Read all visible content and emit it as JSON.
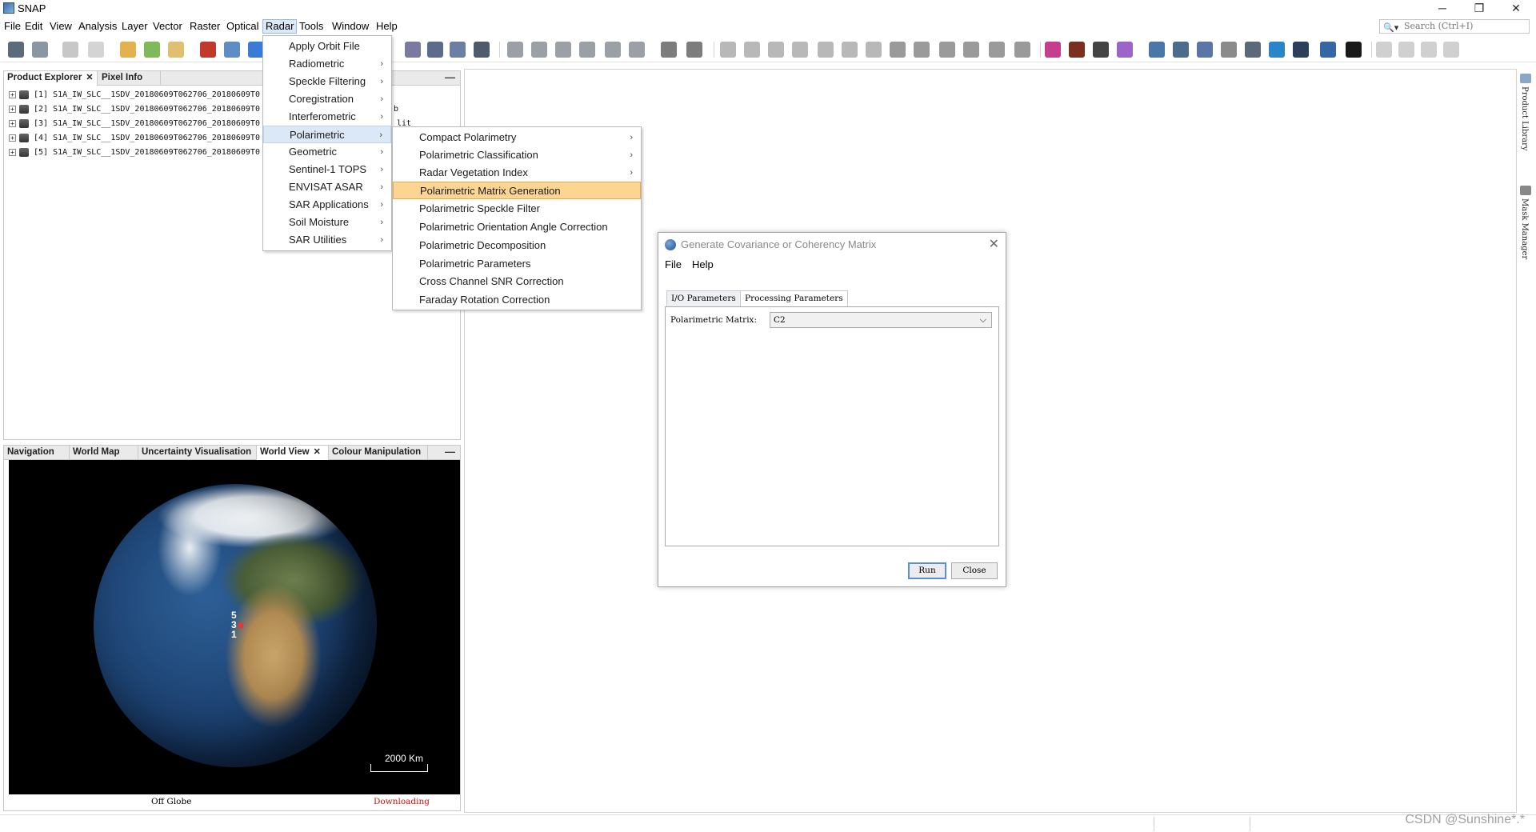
{
  "window": {
    "title": "SNAP",
    "controls": [
      "─",
      "❐",
      "✕"
    ]
  },
  "menubar": {
    "items": [
      "File",
      "Edit",
      "View",
      "Analysis",
      "Layer",
      "Vector",
      "Raster",
      "Optical",
      "Radar",
      "Tools",
      "Window",
      "Help"
    ],
    "active": "Radar",
    "search_placeholder": "Search (Ctrl+I)"
  },
  "product_explorer": {
    "tabs": [
      "Product Explorer",
      "Pixel Info"
    ],
    "minimize": "—",
    "products": [
      "[1] S1A_IW_SLC__1SDV_20180609T062706_20180609T0",
      "[2] S1A_IW_SLC__1SDV_20180609T062706_20180609T0",
      "[3] S1A_IW_SLC__1SDV_20180609T062706_20180609T0",
      "[4] S1A_IW_SLC__1SDV_20180609T062706_20180609T0",
      "[5] S1A_IW_SLC__1SDV_20180609T062706_20180609T0"
    ],
    "behind_text": [
      "b",
      "lit"
    ]
  },
  "world_view_panel": {
    "tabs": [
      "Navigation",
      "World Map",
      "Uncertainty Visualisation",
      "World View",
      "Colour Manipulation"
    ],
    "minimize": "—",
    "markers": [
      "5",
      "3",
      "1"
    ],
    "scale_label": "2000 Km",
    "status_left": "Off Globe",
    "status_right": "Downloading",
    "status_right_color": "#d01010"
  },
  "radar_menu": {
    "items": [
      {
        "label": "Apply Orbit File",
        "submenu": false
      },
      {
        "label": "Radiometric",
        "submenu": true
      },
      {
        "label": "Speckle Filtering",
        "submenu": true
      },
      {
        "label": "Coregistration",
        "submenu": true
      },
      {
        "label": "Interferometric",
        "submenu": true
      },
      {
        "label": "Polarimetric",
        "submenu": true
      },
      {
        "label": "Geometric",
        "submenu": true
      },
      {
        "label": "Sentinel-1 TOPS",
        "submenu": true
      },
      {
        "label": "ENVISAT ASAR",
        "submenu": true
      },
      {
        "label": "SAR Applications",
        "submenu": true
      },
      {
        "label": "Soil Moisture",
        "submenu": true
      },
      {
        "label": "SAR Utilities",
        "submenu": true
      }
    ],
    "hovered": "Polarimetric"
  },
  "polarimetric_menu": {
    "items": [
      {
        "label": "Compact Polarimetry",
        "submenu": true
      },
      {
        "label": "Polarimetric Classification",
        "submenu": true
      },
      {
        "label": "Radar Vegetation Index",
        "submenu": true
      },
      {
        "label": "Polarimetric Matrix Generation",
        "submenu": false
      },
      {
        "label": "Polarimetric Speckle Filter",
        "submenu": false
      },
      {
        "label": "Polarimetric Orientation Angle Correction",
        "submenu": false
      },
      {
        "label": "Polarimetric Decomposition",
        "submenu": false
      },
      {
        "label": "Polarimetric Parameters",
        "submenu": false
      },
      {
        "label": "Cross Channel SNR Correction",
        "submenu": false
      },
      {
        "label": "Faraday Rotation Correction",
        "submenu": false
      }
    ],
    "highlighted": "Polarimetric Matrix Generation",
    "arrow": "›"
  },
  "dialog": {
    "title": "Generate Covariance or Coherency Matrix",
    "close": "✕",
    "menu": [
      "File",
      "Help"
    ],
    "tabs": [
      "I/O Parameters",
      "Processing Parameters"
    ],
    "selected_tab": "Processing Parameters",
    "param_label": "Polarimetric Matrix:",
    "param_value": "C2",
    "run_label": "Run",
    "close_label": "Close"
  },
  "right_sidebar": {
    "labels": [
      "Product Library",
      "Mask Manager"
    ]
  },
  "watermark": "CSDN @Sunshine*.*",
  "colors": {
    "menu_highlight": "#fdd593",
    "menu_hover": "#dbe8f7",
    "accent": "#5a8fd4"
  }
}
